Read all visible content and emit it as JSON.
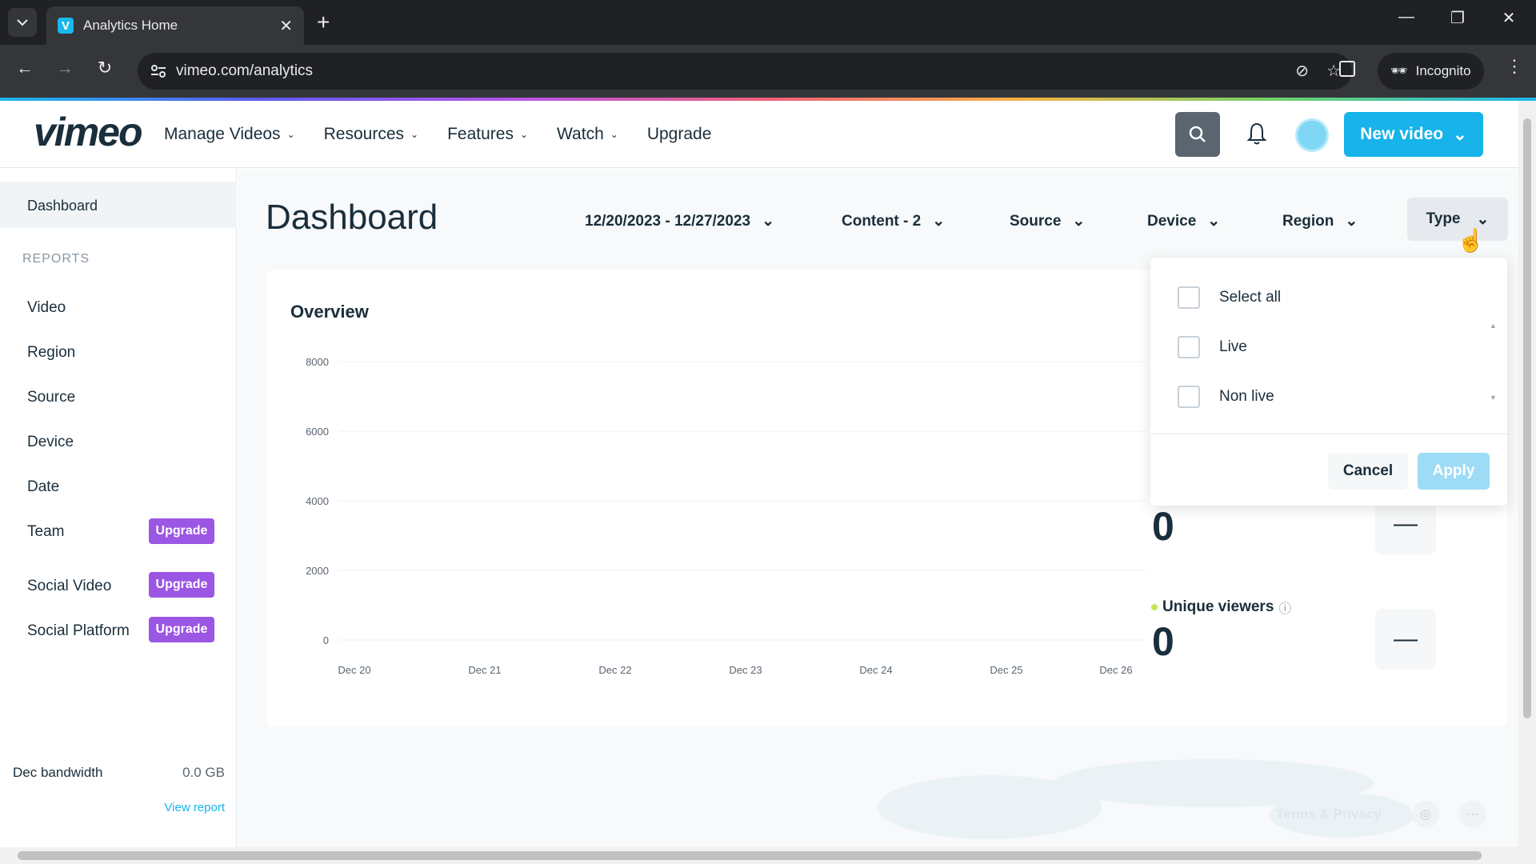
{
  "browser": {
    "tab_title": "Analytics Home",
    "favicon_letter": "V",
    "url": "vimeo.com/analytics",
    "incognito_label": "Incognito",
    "new_tab": "+",
    "tab_close": "✕"
  },
  "header": {
    "logo": "vimeo",
    "nav": [
      "Manage Videos",
      "Resources",
      "Features",
      "Watch",
      "Upgrade"
    ],
    "new_video_label": "New video"
  },
  "sidebar": {
    "dashboard": "Dashboard",
    "section": "REPORTS",
    "items": [
      "Video",
      "Region",
      "Source",
      "Device",
      "Date",
      "Team",
      "Social Video",
      "Social Platform"
    ],
    "upgrade_label": "Upgrade",
    "bandwidth_label": "Dec bandwidth",
    "bandwidth_value": "0.0 GB",
    "view_report": "View report"
  },
  "main": {
    "title": "Dashboard",
    "filters": {
      "date_range": "12/20/2023 - 12/27/2023",
      "content": "Content - 2",
      "source": "Source",
      "device": "Device",
      "region": "Region",
      "type": "Type"
    },
    "overview_title": "Overview",
    "metric_top_value": "0",
    "unique_viewers_label": "Unique viewers",
    "unique_viewers_value": "0",
    "dash": "—"
  },
  "type_dropdown": {
    "options": [
      "Select all",
      "Live",
      "Non live"
    ],
    "cancel": "Cancel",
    "apply": "Apply"
  },
  "footer": {
    "terms": "Terms & Privacy"
  },
  "colors": {
    "accent": "#17b3ea",
    "upgrade": "#9b56e3",
    "viewers_dot": "#c5e55a"
  },
  "chart_data": {
    "type": "line",
    "title": "Overview",
    "categories": [
      "Dec 20",
      "Dec 21",
      "Dec 22",
      "Dec 23",
      "Dec 24",
      "Dec 25",
      "Dec 26"
    ],
    "y_ticks": [
      8000,
      6000,
      4000,
      2000,
      0
    ],
    "ylim": [
      0,
      8000
    ],
    "series": [],
    "grid": true
  }
}
